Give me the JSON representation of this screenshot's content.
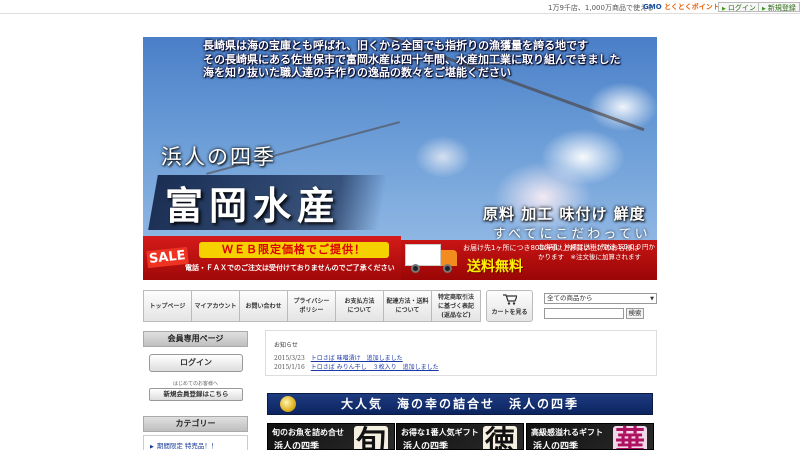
{
  "topbar": {
    "note": "1万9千店、1,000万商品で使える",
    "gmo_logo": "GMO",
    "gmo_logo_sub": "とくとくポイント",
    "login_label": "ログイン",
    "register_label": "新規登録"
  },
  "hero": {
    "intro_lines": [
      "長崎県は海の宝庫とも呼ばれ、旧くから全国でも指折りの漁獲量を誇る地です",
      "その長崎県にある佐世保市で富岡水産は四十年間、水産加工業に取り組んできました",
      "海を知り抜いた職人達の手作りの逸品の数々をご堪能ください"
    ],
    "season": "浜人の四季",
    "company_name": "富岡水産",
    "slogan1": "原料 加工 味付け 鮮度",
    "slogan2": "すべてにこだわっています",
    "sale_badge": "SALE",
    "web_price": "ＷＥＢ限定価格でご提供！",
    "phone_note": "電話・ＦＡＸでのご注文は受付けておりませんのでご了承ください",
    "ship_line1": "お届け先1ヶ所につき8000円以上お買い上げのお客様は",
    "free_shipping": "送料無料",
    "ship_line2": "北海道・沖縄は送料が別途１０００円かかります　※注文後に加算されます"
  },
  "nav": {
    "items": [
      "トップページ",
      "マイアカウント",
      "お問い合わせ",
      "プライバシー\nポリシー",
      "お支払方法\nについて",
      "配達方法・送料\nについて",
      "特定商取引法\nに基づく表記\n(返品など)"
    ],
    "cart_label": "カートを見る"
  },
  "search": {
    "category_selected": "全ての商品から",
    "input_value": "",
    "button_label": "検索"
  },
  "sidebar": {
    "member_heading": "会員専用ページ",
    "login_button": "ログイン",
    "new_customer_note": "はじめてのお客様へ",
    "register_button": "新規会員登録はこちら",
    "category_heading": "カテゴリー",
    "category_items": [
      "期間限定 特売品！！"
    ]
  },
  "news": {
    "title": "お知らせ",
    "items": [
      {
        "date": "2015/3/23",
        "text": "トロさば 味噌漬け　追加しました"
      },
      {
        "date": "2015/1/16",
        "text": "トロさば みりん干し　３枚入り　追加しました"
      }
    ]
  },
  "banner": {
    "title": "大人気　海の幸の詰合せ　浜人の四季"
  },
  "gifts": [
    {
      "title": "旬のお魚を詰め合せ",
      "sub": "浜人の四季",
      "kanji": "旬"
    },
    {
      "title": "お得な1番人気ギフト",
      "sub": "浜人の四季",
      "kanji": "徳"
    },
    {
      "title": "高級感溢れるギフト",
      "sub": "浜人の四季",
      "kanji": "華"
    }
  ],
  "colors": {
    "sale_red": "#c81414",
    "banner_navy": "#0c2460",
    "free_yellow": "#fff200"
  }
}
